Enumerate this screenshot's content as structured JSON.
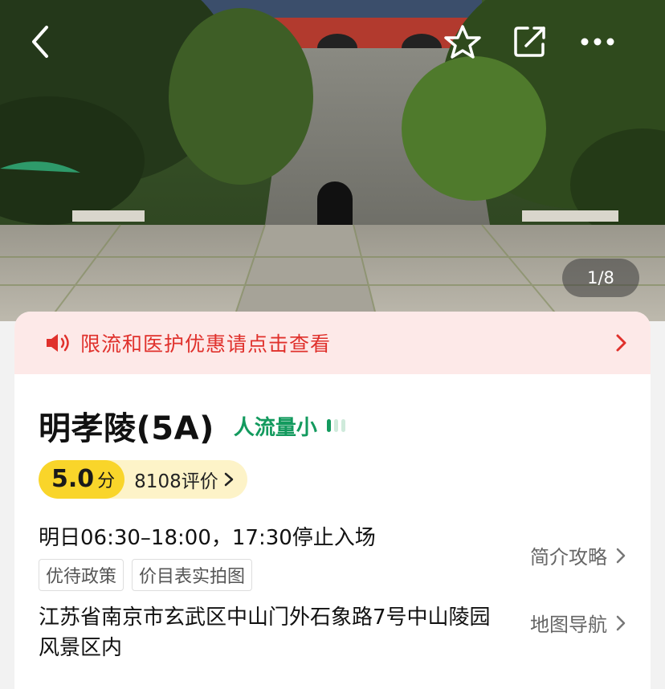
{
  "header": {
    "photo_counter": "1/8"
  },
  "notice": {
    "text": "限流和医护优惠请点击查看"
  },
  "attraction": {
    "name": "明孝陵(5A)",
    "crowd_status": "人流量小",
    "crowd_level": 1,
    "crowd_level_max": 3,
    "score": "5.0",
    "score_unit": "分",
    "review_count": "8108评价"
  },
  "info": {
    "hours": "明日06:30–18:00，17:30停止入场",
    "tags": [
      "优待政策",
      "价目表实拍图"
    ],
    "intro_link": "简介攻略",
    "address": "江苏省南京市玄武区中山门外石象路7号中山陵园风景区内",
    "map_link": "地图导航"
  },
  "colors": {
    "notice_red": "#e0312c",
    "crowd_green": "#139a5e",
    "score_yellow": "#f9d52a"
  }
}
